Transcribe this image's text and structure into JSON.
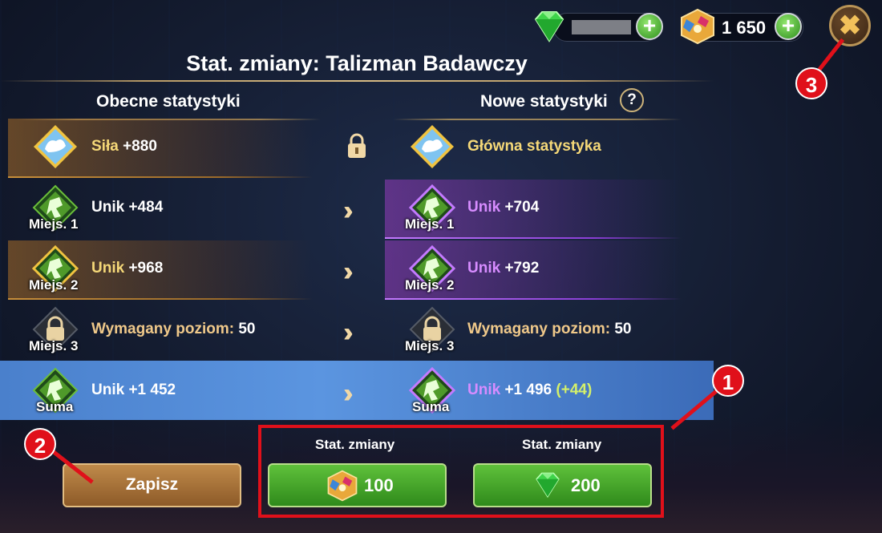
{
  "header": {
    "title": "Stat. zmiany: Talizman Badawczy",
    "gold_amount": "1 650",
    "close_icon": "close-icon"
  },
  "columns": {
    "current": "Obecne statystyki",
    "new": "Nowe statystyki",
    "help": "?"
  },
  "rows": [
    {
      "left_name": "Siła",
      "left_value": " +880",
      "left_slot": "",
      "right_name": "Główna statystyka",
      "right_value": "",
      "right_slot": "",
      "middle": "lock"
    },
    {
      "left_name": "Unik",
      "left_value": " +484",
      "left_slot": "Miejs. 1",
      "right_name": "Unik",
      "right_value": " +704",
      "right_slot": "Miejs. 1",
      "middle": "arrows"
    },
    {
      "left_name": "Unik",
      "left_value": " +968",
      "left_slot": "Miejs. 2",
      "right_name": "Unik",
      "right_value": " +792",
      "right_slot": "Miejs. 2",
      "middle": "arrows"
    },
    {
      "left_name": "Wymagany poziom:",
      "left_value": " 50",
      "left_slot": "Miejs. 3",
      "right_name": "Wymagany poziom:",
      "right_value": " 50",
      "right_slot": "Miejs. 3",
      "middle": "arrows"
    },
    {
      "left_name": "Unik",
      "left_value": " +1 452",
      "left_slot": "Suma",
      "right_name": "Unik",
      "right_value": " +1 496 ",
      "right_bonus": "(+44)",
      "right_slot": "Suma",
      "middle": "arrows"
    }
  ],
  "arrow_glyph": "››",
  "footer": {
    "save_label": "Zapisz",
    "option1_label": "Stat. zmiany",
    "option1_cost": "100",
    "option2_label": "Stat. zmiany",
    "option2_cost": "200"
  },
  "callouts": [
    "1",
    "2",
    "3"
  ],
  "colors": {
    "highlight": "#e0101a",
    "accent_gold": "#f5d878",
    "accent_purple": "#d78cff",
    "button_green": "#3fa52a"
  }
}
